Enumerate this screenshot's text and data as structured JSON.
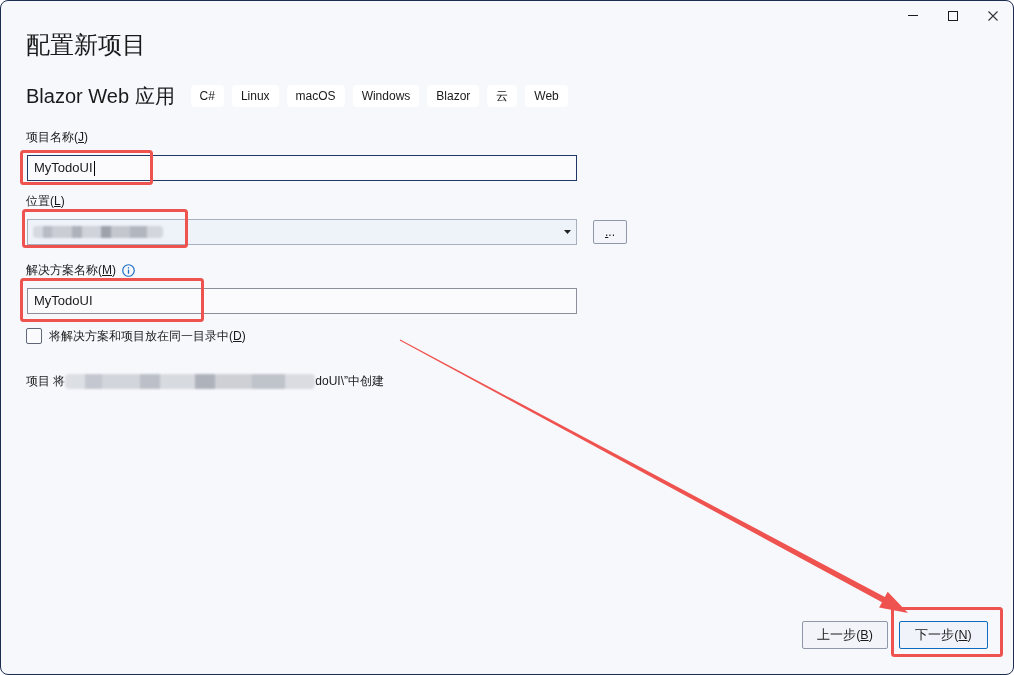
{
  "window": {
    "title": "配置新项目"
  },
  "template": {
    "name": "Blazor Web 应用",
    "tags": [
      "C#",
      "Linux",
      "macOS",
      "Windows",
      "Blazor",
      "云",
      "Web"
    ]
  },
  "fields": [
    {
      "kind": "text",
      "label": {
        "before": "项目名称(",
        "access_key": "J",
        "after": ")"
      },
      "value": "MyTodoUI",
      "focused": true
    },
    {
      "kind": "combo",
      "label": {
        "before": "位置(",
        "access_key": "L",
        "after": ")"
      },
      "value_blurred": true,
      "browse_button": {
        "access_key": ".",
        "after": ".."
      }
    },
    {
      "kind": "text",
      "label": {
        "before": "解决方案名称(",
        "access_key": "M",
        "after": ")"
      },
      "info": true,
      "value": "MyTodoUI",
      "focused": false
    }
  ],
  "option": {
    "label": {
      "before": "将解决方案和项目放在同一目录中(",
      "access_key": "D",
      "after": ")"
    },
    "checked": false
  },
  "status": {
    "before": "项目 将",
    "blurred": true,
    "after": "doUI\\”中创建"
  },
  "buttons": [
    {
      "label": {
        "before": "上一步(",
        "access_key": "B",
        "after": ")"
      },
      "default": false
    },
    {
      "label": {
        "before": "下一步(",
        "access_key": "N",
        "after": ")"
      },
      "default": true
    }
  ]
}
